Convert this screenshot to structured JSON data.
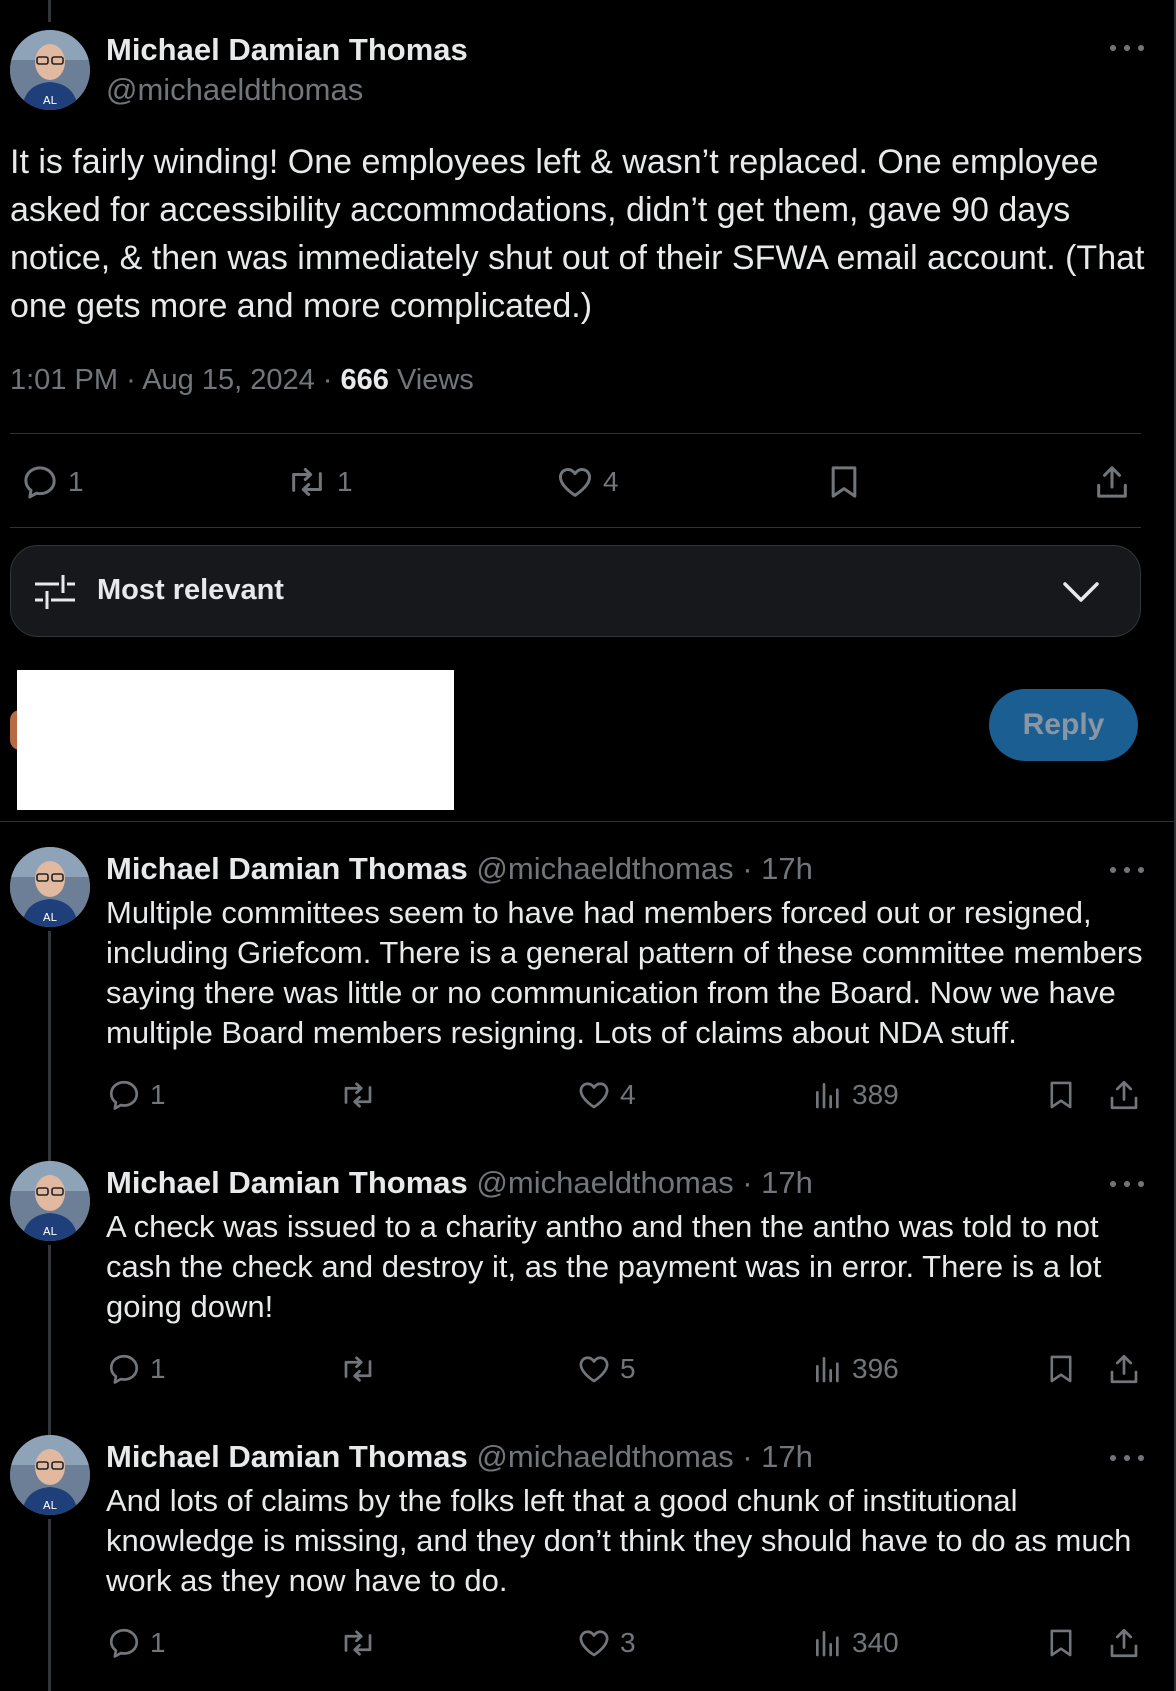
{
  "main_tweet": {
    "author_name": "Michael Damian Thomas",
    "author_handle": "@michaeldthomas",
    "text": "It is fairly winding! One employees left & wasn’t replaced. One employee asked for accessibility accommodations, didn’t get them, gave 90 days notice, & then was immediately shut out of their SFWA email account. (That one gets more and more complicated.)",
    "time": "1:01 PM",
    "date": "Aug 15, 2024",
    "views_count": "666",
    "views_label": "Views",
    "replies": "1",
    "reposts": "1",
    "likes": "4"
  },
  "sort": {
    "label": "Most relevant"
  },
  "compose": {
    "reply_label": "Reply"
  },
  "replies": [
    {
      "author_name": "Michael Damian Thomas",
      "author_handle": "@michaeldthomas",
      "age": "17h",
      "text": "Multiple committees seem to have had members forced out or resigned, including Griefcom. There is a general pattern of these committee members saying there was little or no communication from the Board. Now we have multiple Board members resigning. Lots of claims about NDA stuff.",
      "replies": "1",
      "reposts": "",
      "likes": "4",
      "views": "389"
    },
    {
      "author_name": "Michael Damian Thomas",
      "author_handle": "@michaeldthomas",
      "age": "17h",
      "text": "A check was issued to a charity antho and then the antho was told to not cash the check and destroy it, as the payment was in error. There is a lot going down!",
      "replies": "1",
      "reposts": "",
      "likes": "5",
      "views": "396"
    },
    {
      "author_name": "Michael Damian Thomas",
      "author_handle": "@michaeldthomas",
      "age": "17h",
      "text": "And lots of claims by the folks left that a good chunk of institutional knowledge is missing, and they don’t think they should have to do as much work as they now have to do.",
      "replies": "1",
      "reposts": "",
      "likes": "3",
      "views": "340"
    }
  ]
}
